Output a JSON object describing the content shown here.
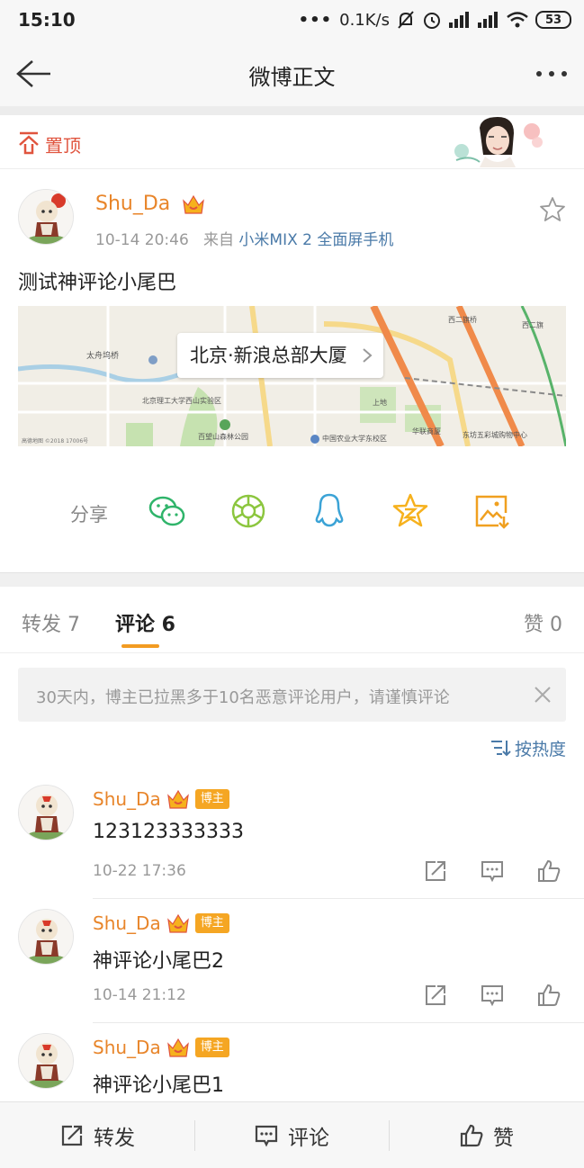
{
  "status": {
    "time": "15:10",
    "network_speed": "0.1K/s",
    "battery": "53"
  },
  "nav": {
    "title": "微博正文"
  },
  "pin": {
    "label": "置顶"
  },
  "post": {
    "author": "Shu_Da",
    "time": "10-14 20:46",
    "source_prefix": "来自",
    "source": "小米MIX 2 全面屏手机",
    "text": "测试神评论小尾巴",
    "location": "北京·新浪总部大厦"
  },
  "map_labels": {
    "l1": "太舟坞桥",
    "l2": "北京理工大学西山实验区",
    "l3": "百望山森林公园",
    "l4": "中国农业大学东校区",
    "l5": "西二旗桥",
    "l6": "华联商厦",
    "l7": "东坊五彩城购物中心",
    "l8": "西二旗",
    "l9": "上地",
    "copyright": "高德地图 ©2018 17006号"
  },
  "share": {
    "label": "分享",
    "items": [
      "wechat",
      "moments",
      "qq",
      "qzone",
      "save-image"
    ]
  },
  "tabs": {
    "repost": "转发 7",
    "comments": "评论 6",
    "likes": "赞 0"
  },
  "notice": {
    "text": "30天内，博主已拉黑多于10名恶意评论用户，请谨慎评论"
  },
  "sort": {
    "label": "按热度"
  },
  "comments": [
    {
      "name": "Shu_Da",
      "badge": "博主",
      "text": "123123333333",
      "time": "10-22 17:36"
    },
    {
      "name": "Shu_Da",
      "badge": "博主",
      "text": "神评论小尾巴2",
      "time": "10-14 21:12"
    },
    {
      "name": "Shu_Da",
      "badge": "博主",
      "text": "神评论小尾巴1",
      "time": ""
    }
  ],
  "bottom": {
    "repost": "转发",
    "comment": "评论",
    "like": "赞"
  },
  "colors": {
    "author_orange": "#e8852a",
    "link_blue": "#4a7aa8",
    "pin_red": "#e0543e",
    "tab_underline": "#f29b22",
    "badge_bg": "#f5a623"
  }
}
